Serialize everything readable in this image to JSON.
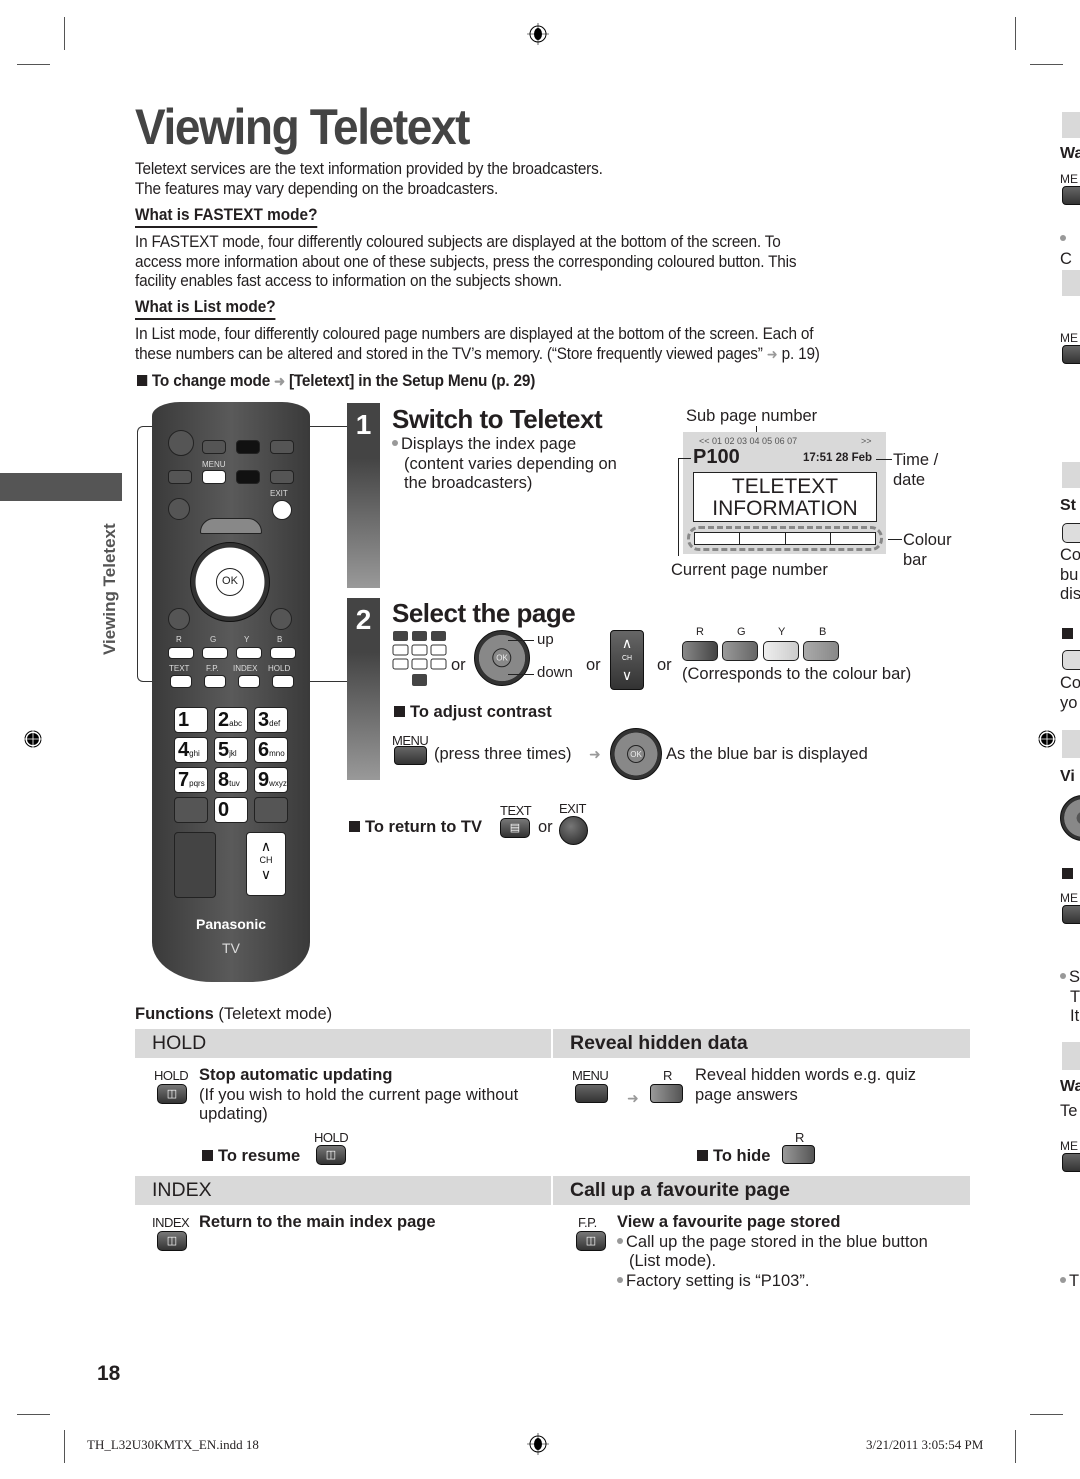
{
  "page": {
    "title": "Viewing Teletext",
    "side_tab_label": "Viewing Teletext",
    "intro": [
      "Teletext services are the text information provided by the broadcasters.",
      "The features may vary depending on the broadcasters."
    ],
    "fastext": {
      "heading": "What is FASTEXT mode?",
      "lines": [
        "In FASTEXT mode, four differently coloured subjects are displayed at the bottom of the screen. To",
        "access more information about one of these subjects, press the corresponding coloured button. This",
        "facility enables fast access to information on the subjects shown."
      ]
    },
    "list_mode": {
      "heading": "What is List mode?",
      "lines": [
        "In List mode, four differently coloured page numbers are displayed at the bottom of the screen. Each of",
        "these numbers can be altered and stored in the TV’s memory. (“Store frequently viewed pages”",
        "p. 19)"
      ]
    },
    "change_mode": {
      "prefix": "To change mode",
      "suffix": "[Teletext] in the Setup Menu (p. 29)"
    },
    "page_number": "18"
  },
  "remote": {
    "labels": {
      "menu": "MENU",
      "exit": "EXIT",
      "ok": "OK",
      "r": "R",
      "g": "G",
      "y": "Y",
      "b": "B",
      "text": "TEXT",
      "fp": "F.P.",
      "index": "INDEX",
      "hold": "HOLD",
      "ch": "CH",
      "brand": "Panasonic",
      "tv": "TV"
    },
    "numbers": [
      {
        "d": "1",
        "s": ""
      },
      {
        "d": "2",
        "s": "abc"
      },
      {
        "d": "3",
        "s": "def"
      },
      {
        "d": "4",
        "s": "ghi"
      },
      {
        "d": "5",
        "s": "jkl"
      },
      {
        "d": "6",
        "s": "mno"
      },
      {
        "d": "7",
        "s": "pqrs"
      },
      {
        "d": "8",
        "s": "tuv"
      },
      {
        "d": "9",
        "s": "wxyz"
      },
      {
        "d": "0",
        "s": ""
      }
    ]
  },
  "step1": {
    "number": "1",
    "title": "Switch to Teletext",
    "lines": [
      "Displays the index page",
      "(content varies depending on",
      "the broadcasters)"
    ]
  },
  "screen": {
    "subpage_label": "Sub page number",
    "subpages": "<< 01 02 03 04 05 06 07",
    "subpages_next": ">>",
    "page": "P100",
    "time": "17:51 28 Feb",
    "time_label_1": "Time /",
    "time_label_2": "date",
    "content_1": "TELETEXT",
    "content_2": "INFORMATION",
    "colour_label_1": "Colour",
    "colour_label_2": "bar",
    "current_label": "Current page number"
  },
  "step2": {
    "number": "2",
    "title": "Select the page",
    "or": "or",
    "up": "up",
    "down": "down",
    "ch": "CH",
    "colour_keys": [
      "R",
      "G",
      "Y",
      "B"
    ],
    "colour_note": "(Corresponds to the colour bar)",
    "contrast_heading": "To adjust contrast",
    "menu": "MENU",
    "press_three": "(press three times)",
    "blue_bar": "As the blue bar is displayed"
  },
  "return_tv": {
    "label": "To return to TV",
    "text_key": "TEXT",
    "exit_key": "EXIT",
    "or": "or"
  },
  "functions": {
    "heading_bold": "Functions",
    "heading_rest": "(Teletext mode)",
    "hold": {
      "header": "HOLD",
      "key": "HOLD",
      "title": "Stop automatic updating",
      "lines": [
        "(If you wish to hold the current page without",
        "updating)"
      ],
      "resume": "To resume",
      "resume_key": "HOLD"
    },
    "reveal": {
      "header": "Reveal hidden data",
      "key1": "MENU",
      "key2": "R",
      "lines": [
        "Reveal hidden words e.g. quiz",
        "page answers"
      ],
      "hide": "To hide",
      "hide_key": "R"
    },
    "index": {
      "header": "INDEX",
      "key": "INDEX",
      "title": "Return to the main index page"
    },
    "favourite": {
      "header": "Call up a favourite page",
      "key": "F.P.",
      "title": "View a favourite page stored",
      "lines": [
        "Call up the page stored in the blue button",
        "(List mode).",
        "Factory setting is “P103”."
      ]
    }
  },
  "right_edge": {
    "texts": [
      "Wa",
      "ME",
      "C",
      "ME",
      "St",
      "Co",
      "bu",
      "dis",
      "Co",
      "yo",
      "Vi",
      "ME",
      "S",
      "T",
      "It",
      "Wa",
      "Te",
      "ME",
      "T"
    ]
  },
  "footer": {
    "file": "TH_L32U30KMTX_EN.indd   18",
    "timestamp": "3/21/2011   3:05:54 PM"
  }
}
